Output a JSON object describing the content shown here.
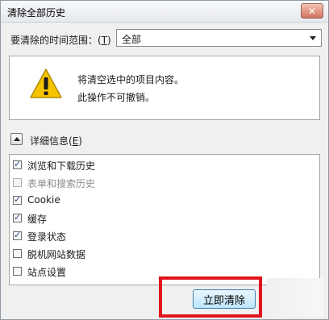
{
  "window": {
    "title": "清除全部历史"
  },
  "range": {
    "label": "要清除的时间范围：",
    "hotkey_open": "(",
    "hotkey": "T",
    "hotkey_close": ")",
    "value": "全部"
  },
  "warning": {
    "line1": "将清空选中的项目内容。",
    "line2": "此操作不可撤销。"
  },
  "details": {
    "label": "详细信息",
    "hotkey_open": "(",
    "hotkey": "E",
    "hotkey_close": ")"
  },
  "items": [
    {
      "label": "浏览和下载历史",
      "checked": true,
      "disabled": false
    },
    {
      "label": "表单和搜索历史",
      "checked": false,
      "disabled": true
    },
    {
      "label": "Cookie",
      "checked": true,
      "disabled": false
    },
    {
      "label": "缓存",
      "checked": true,
      "disabled": false
    },
    {
      "label": "登录状态",
      "checked": true,
      "disabled": false
    },
    {
      "label": "脱机网站数据",
      "checked": false,
      "disabled": false
    },
    {
      "label": "站点设置",
      "checked": false,
      "disabled": false
    }
  ],
  "buttons": {
    "clear_now": "立即清除",
    "close_glyph": "✕"
  },
  "colors": {
    "highlight_box": "#e0151c",
    "warning_yellow": "#f5c400"
  },
  "icons": [
    "warning-icon",
    "close-icon",
    "chevron-down-icon",
    "chevron-up-icon",
    "checkbox"
  ]
}
